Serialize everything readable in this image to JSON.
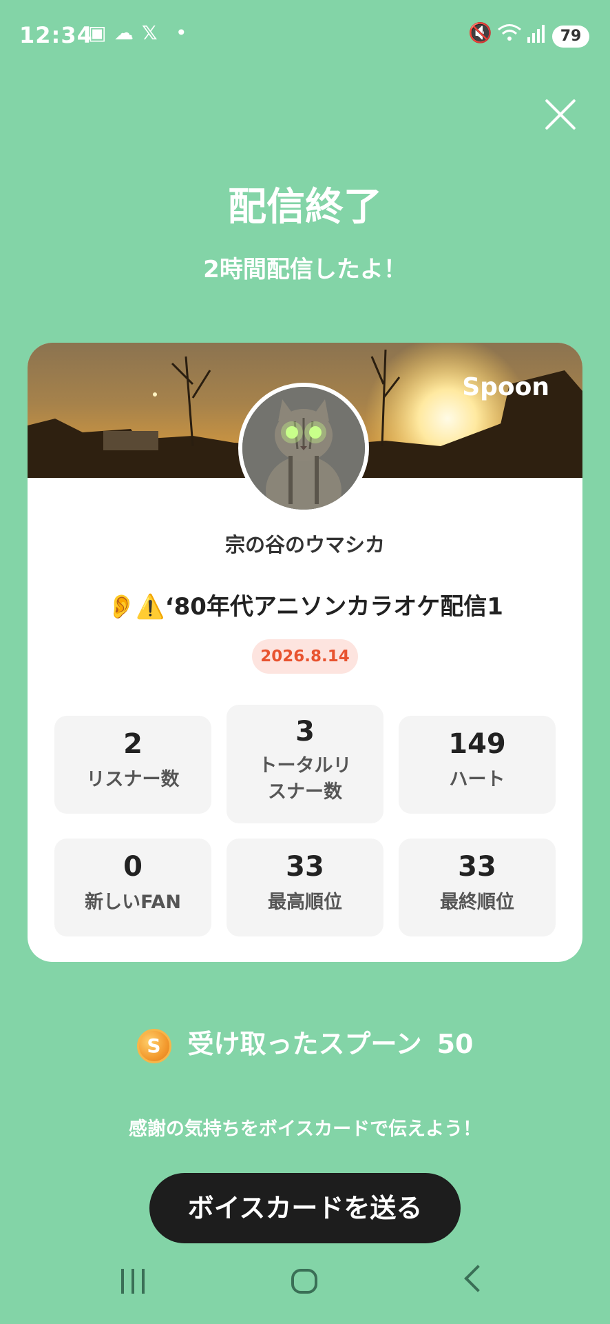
{
  "status_bar": {
    "time": "12:34",
    "battery": "79",
    "icons": [
      "screenshot-icon",
      "cloud-icon",
      "x-icon",
      "dot-icon",
      "mute-icon",
      "wifi-icon",
      "signal-icon"
    ]
  },
  "header": {
    "title": "配信終了",
    "subtitle": "2時間配信したよ！"
  },
  "card": {
    "brand": "Spoon",
    "username": "宗の谷のウマシカ",
    "broadcast_title": "👂⚠️‘80年代アニソンカラオケ配信1",
    "date": "2026.8.14",
    "stats": [
      {
        "value": "2",
        "label": "リスナー数"
      },
      {
        "value": "3",
        "label": "トータルリスナー数"
      },
      {
        "value": "149",
        "label": "ハート"
      },
      {
        "value": "0",
        "label": "新しいFAN"
      },
      {
        "value": "33",
        "label": "最高順位"
      },
      {
        "value": "33",
        "label": "最終順位"
      }
    ]
  },
  "spoons": {
    "coin_glyph": "S",
    "label": "受け取ったスプーン",
    "value": "50"
  },
  "thanks_text": "感謝の気持ちをボイスカードで伝えよう！",
  "voice_card_button": "ボイスカードを送る",
  "colors": {
    "background": "#83d4a7",
    "button": "#1d1d1d",
    "date_text": "#e8532f",
    "date_bg": "#fde4df"
  }
}
